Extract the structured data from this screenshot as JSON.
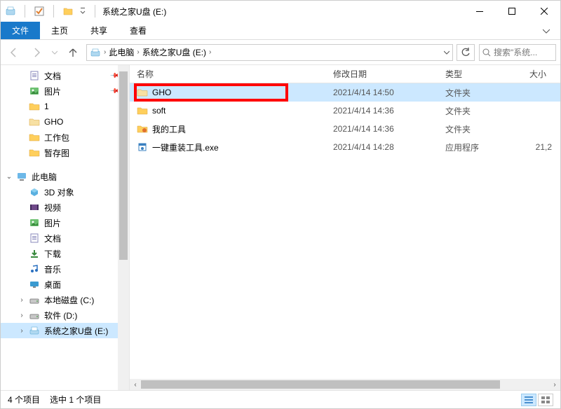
{
  "window": {
    "title": "系统之家U盘 (E:)"
  },
  "ribbon": {
    "file": "文件",
    "home": "主页",
    "share": "共享",
    "view": "查看"
  },
  "address": {
    "this_pc": "此电脑",
    "drive": "系统之家U盘 (E:)",
    "search_placeholder": "搜索\"系统..."
  },
  "tree": {
    "scroll": {
      "top_pct": 2,
      "height_pct": 58
    },
    "quick": [
      {
        "label": "文档",
        "pinned": true,
        "icon": "doc"
      },
      {
        "label": "图片",
        "pinned": true,
        "icon": "pic"
      },
      {
        "label": "1",
        "pinned": false,
        "icon": "folder"
      },
      {
        "label": "GHO",
        "pinned": false,
        "icon": "folder-dim"
      },
      {
        "label": "工作包",
        "pinned": false,
        "icon": "folder"
      },
      {
        "label": "暂存图",
        "pinned": false,
        "icon": "folder"
      }
    ],
    "this_pc": "此电脑",
    "pc_children": [
      {
        "label": "3D 对象",
        "icon": "3d"
      },
      {
        "label": "视频",
        "icon": "video"
      },
      {
        "label": "图片",
        "icon": "pic"
      },
      {
        "label": "文档",
        "icon": "doc"
      },
      {
        "label": "下载",
        "icon": "dl"
      },
      {
        "label": "音乐",
        "icon": "music"
      },
      {
        "label": "桌面",
        "icon": "desk"
      },
      {
        "label": "本地磁盘 (C:)",
        "icon": "drive",
        "expandable": true
      },
      {
        "label": "软件 (D:)",
        "icon": "drive",
        "expandable": true
      },
      {
        "label": "系统之家U盘 (E:)",
        "icon": "drive-blue",
        "expandable": true,
        "selected": true
      }
    ]
  },
  "columns": {
    "name": "名称",
    "date": "修改日期",
    "type": "类型",
    "size": "大小"
  },
  "files": [
    {
      "name": "GHO",
      "date": "2021/4/14 14:50",
      "type": "文件夹",
      "size": "",
      "icon": "folder-dim",
      "selected": true,
      "highlight": true
    },
    {
      "name": "soft",
      "date": "2021/4/14 14:36",
      "type": "文件夹",
      "size": "",
      "icon": "folder"
    },
    {
      "name": "我的工具",
      "date": "2021/4/14 14:36",
      "type": "文件夹",
      "size": "",
      "icon": "folder-fancy"
    },
    {
      "name": "一键重装工具.exe",
      "date": "2021/4/14 14:28",
      "type": "应用程序",
      "size": "21,2",
      "icon": "exe"
    }
  ],
  "hscroll": {
    "left_pct": 0,
    "width_pct": 88
  },
  "status": {
    "count": "4 个项目",
    "selected": "选中 1 个项目"
  }
}
